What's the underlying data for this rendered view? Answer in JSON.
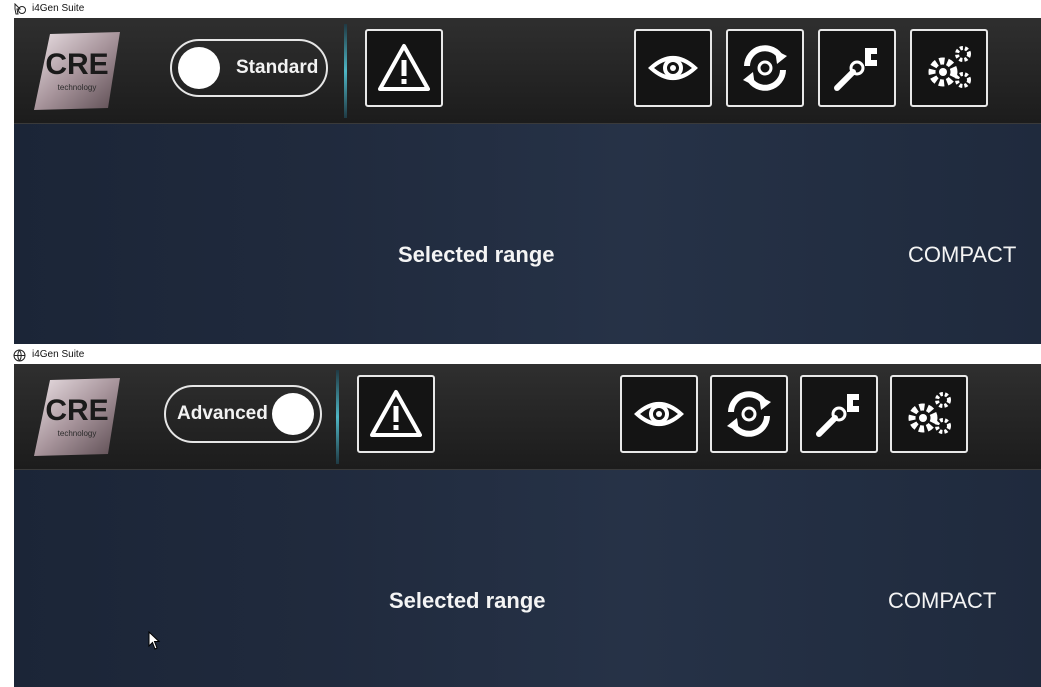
{
  "window1": {
    "title": "i4Gen Suite",
    "mode_label": "Standard",
    "selected_range_label": "Selected range",
    "selected_range_value": "COMPACT"
  },
  "window2": {
    "title": "i4Gen Suite",
    "mode_label": "Advanced",
    "selected_range_label": "Selected range",
    "selected_range_value": "COMPACT"
  },
  "logo": {
    "text": "CRE",
    "subtext": "technology"
  },
  "toolbar_icons": [
    "warning-icon",
    "eye-icon",
    "sync-icon",
    "tools-icon",
    "settings-gears-icon"
  ],
  "colors": {
    "toolbar_bg": "#262626",
    "main_bg": "#222c40",
    "accent_divider": "#4fb6c5",
    "text": "#f4f4f4"
  }
}
